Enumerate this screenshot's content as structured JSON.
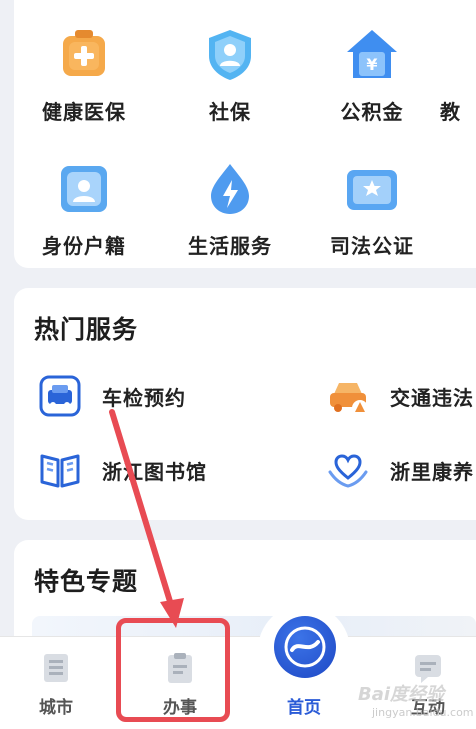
{
  "services": {
    "row1": [
      "健康医保",
      "社保",
      "公积金",
      "教"
    ],
    "row2": [
      "身份户籍",
      "生活服务",
      "司法公证"
    ]
  },
  "hot": {
    "title": "热门服务",
    "items": [
      "车检预约",
      "交通违法",
      "浙江图书馆",
      "浙里康养"
    ]
  },
  "featured": {
    "title": "特色专题"
  },
  "tabbar": {
    "tabs": [
      "城市",
      "办事",
      "首页",
      "互动"
    ],
    "active": "首页"
  },
  "watermark": {
    "main": "Bai度经验",
    "sub": "jingyan.baidu.com"
  },
  "colors": {
    "accent": "#2a5bd7",
    "annotation": "#e84b53",
    "icon_orange": "#f2a13d",
    "icon_blue": "#4ea3f0"
  }
}
